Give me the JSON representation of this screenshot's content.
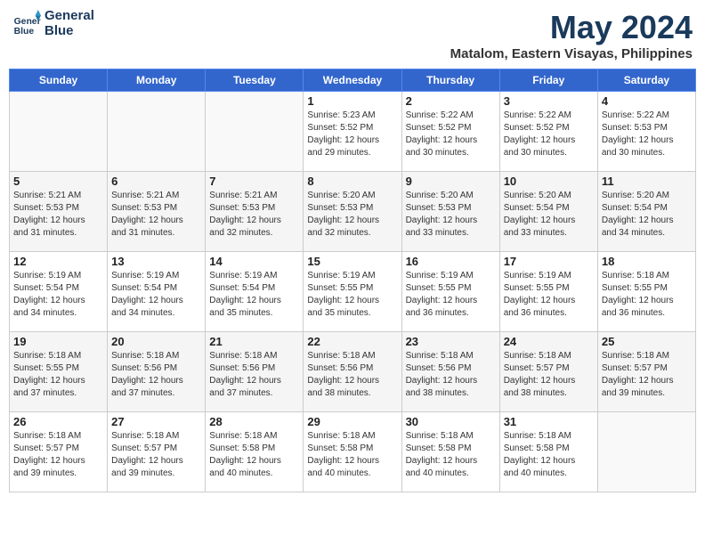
{
  "header": {
    "logo_line1": "General",
    "logo_line2": "Blue",
    "month": "May 2024",
    "location": "Matalom, Eastern Visayas, Philippines"
  },
  "weekdays": [
    "Sunday",
    "Monday",
    "Tuesday",
    "Wednesday",
    "Thursday",
    "Friday",
    "Saturday"
  ],
  "weeks": [
    [
      {
        "day": "",
        "info": ""
      },
      {
        "day": "",
        "info": ""
      },
      {
        "day": "",
        "info": ""
      },
      {
        "day": "1",
        "info": "Sunrise: 5:23 AM\nSunset: 5:52 PM\nDaylight: 12 hours\nand 29 minutes."
      },
      {
        "day": "2",
        "info": "Sunrise: 5:22 AM\nSunset: 5:52 PM\nDaylight: 12 hours\nand 30 minutes."
      },
      {
        "day": "3",
        "info": "Sunrise: 5:22 AM\nSunset: 5:52 PM\nDaylight: 12 hours\nand 30 minutes."
      },
      {
        "day": "4",
        "info": "Sunrise: 5:22 AM\nSunset: 5:53 PM\nDaylight: 12 hours\nand 30 minutes."
      }
    ],
    [
      {
        "day": "5",
        "info": "Sunrise: 5:21 AM\nSunset: 5:53 PM\nDaylight: 12 hours\nand 31 minutes."
      },
      {
        "day": "6",
        "info": "Sunrise: 5:21 AM\nSunset: 5:53 PM\nDaylight: 12 hours\nand 31 minutes."
      },
      {
        "day": "7",
        "info": "Sunrise: 5:21 AM\nSunset: 5:53 PM\nDaylight: 12 hours\nand 32 minutes."
      },
      {
        "day": "8",
        "info": "Sunrise: 5:20 AM\nSunset: 5:53 PM\nDaylight: 12 hours\nand 32 minutes."
      },
      {
        "day": "9",
        "info": "Sunrise: 5:20 AM\nSunset: 5:53 PM\nDaylight: 12 hours\nand 33 minutes."
      },
      {
        "day": "10",
        "info": "Sunrise: 5:20 AM\nSunset: 5:54 PM\nDaylight: 12 hours\nand 33 minutes."
      },
      {
        "day": "11",
        "info": "Sunrise: 5:20 AM\nSunset: 5:54 PM\nDaylight: 12 hours\nand 34 minutes."
      }
    ],
    [
      {
        "day": "12",
        "info": "Sunrise: 5:19 AM\nSunset: 5:54 PM\nDaylight: 12 hours\nand 34 minutes."
      },
      {
        "day": "13",
        "info": "Sunrise: 5:19 AM\nSunset: 5:54 PM\nDaylight: 12 hours\nand 34 minutes."
      },
      {
        "day": "14",
        "info": "Sunrise: 5:19 AM\nSunset: 5:54 PM\nDaylight: 12 hours\nand 35 minutes."
      },
      {
        "day": "15",
        "info": "Sunrise: 5:19 AM\nSunset: 5:55 PM\nDaylight: 12 hours\nand 35 minutes."
      },
      {
        "day": "16",
        "info": "Sunrise: 5:19 AM\nSunset: 5:55 PM\nDaylight: 12 hours\nand 36 minutes."
      },
      {
        "day": "17",
        "info": "Sunrise: 5:19 AM\nSunset: 5:55 PM\nDaylight: 12 hours\nand 36 minutes."
      },
      {
        "day": "18",
        "info": "Sunrise: 5:18 AM\nSunset: 5:55 PM\nDaylight: 12 hours\nand 36 minutes."
      }
    ],
    [
      {
        "day": "19",
        "info": "Sunrise: 5:18 AM\nSunset: 5:55 PM\nDaylight: 12 hours\nand 37 minutes."
      },
      {
        "day": "20",
        "info": "Sunrise: 5:18 AM\nSunset: 5:56 PM\nDaylight: 12 hours\nand 37 minutes."
      },
      {
        "day": "21",
        "info": "Sunrise: 5:18 AM\nSunset: 5:56 PM\nDaylight: 12 hours\nand 37 minutes."
      },
      {
        "day": "22",
        "info": "Sunrise: 5:18 AM\nSunset: 5:56 PM\nDaylight: 12 hours\nand 38 minutes."
      },
      {
        "day": "23",
        "info": "Sunrise: 5:18 AM\nSunset: 5:56 PM\nDaylight: 12 hours\nand 38 minutes."
      },
      {
        "day": "24",
        "info": "Sunrise: 5:18 AM\nSunset: 5:57 PM\nDaylight: 12 hours\nand 38 minutes."
      },
      {
        "day": "25",
        "info": "Sunrise: 5:18 AM\nSunset: 5:57 PM\nDaylight: 12 hours\nand 39 minutes."
      }
    ],
    [
      {
        "day": "26",
        "info": "Sunrise: 5:18 AM\nSunset: 5:57 PM\nDaylight: 12 hours\nand 39 minutes."
      },
      {
        "day": "27",
        "info": "Sunrise: 5:18 AM\nSunset: 5:57 PM\nDaylight: 12 hours\nand 39 minutes."
      },
      {
        "day": "28",
        "info": "Sunrise: 5:18 AM\nSunset: 5:58 PM\nDaylight: 12 hours\nand 40 minutes."
      },
      {
        "day": "29",
        "info": "Sunrise: 5:18 AM\nSunset: 5:58 PM\nDaylight: 12 hours\nand 40 minutes."
      },
      {
        "day": "30",
        "info": "Sunrise: 5:18 AM\nSunset: 5:58 PM\nDaylight: 12 hours\nand 40 minutes."
      },
      {
        "day": "31",
        "info": "Sunrise: 5:18 AM\nSunset: 5:58 PM\nDaylight: 12 hours\nand 40 minutes."
      },
      {
        "day": "",
        "info": ""
      }
    ]
  ]
}
